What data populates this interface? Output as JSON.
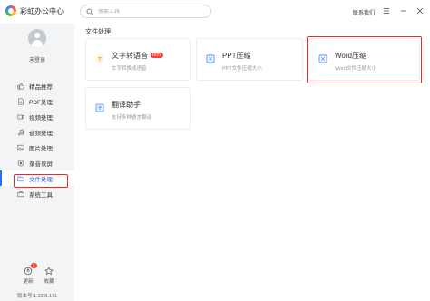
{
  "app": {
    "title": "彩虹办公中心"
  },
  "search": {
    "placeholder": "搜索工具"
  },
  "header": {
    "contact": "联系我们"
  },
  "user": {
    "login_label": "未登录"
  },
  "sidebar": {
    "items": [
      {
        "label": "精品推荐",
        "icon": "thumbs-up-icon"
      },
      {
        "label": "PDF处理",
        "icon": "pdf-icon"
      },
      {
        "label": "视频处理",
        "icon": "video-icon"
      },
      {
        "label": "音频处理",
        "icon": "audio-icon"
      },
      {
        "label": "图片处理",
        "icon": "image-icon"
      },
      {
        "label": "录音录屏",
        "icon": "record-icon"
      },
      {
        "label": "文件处理",
        "icon": "folder-icon",
        "active": true
      },
      {
        "label": "系统工具",
        "icon": "toolbox-icon"
      }
    ],
    "update_label": "更新",
    "update_badge": "2",
    "favorite_label": "收藏",
    "version": "版本号:1.22.8.171"
  },
  "main": {
    "section_title": "文件处理",
    "cards": [
      {
        "title": "文字转语音",
        "badge": "HOT",
        "desc": "文字转换成语音"
      },
      {
        "title": "PPT压缩",
        "desc": "PPT文件压缩大小"
      },
      {
        "title": "Word压缩",
        "desc": "Word文件压缩大小"
      },
      {
        "title": "翻译助手",
        "desc": "支持多种语言翻译"
      }
    ]
  },
  "colors": {
    "accent": "#2f6bff",
    "highlight_border": "#e0302a",
    "badge": "#f04134"
  }
}
